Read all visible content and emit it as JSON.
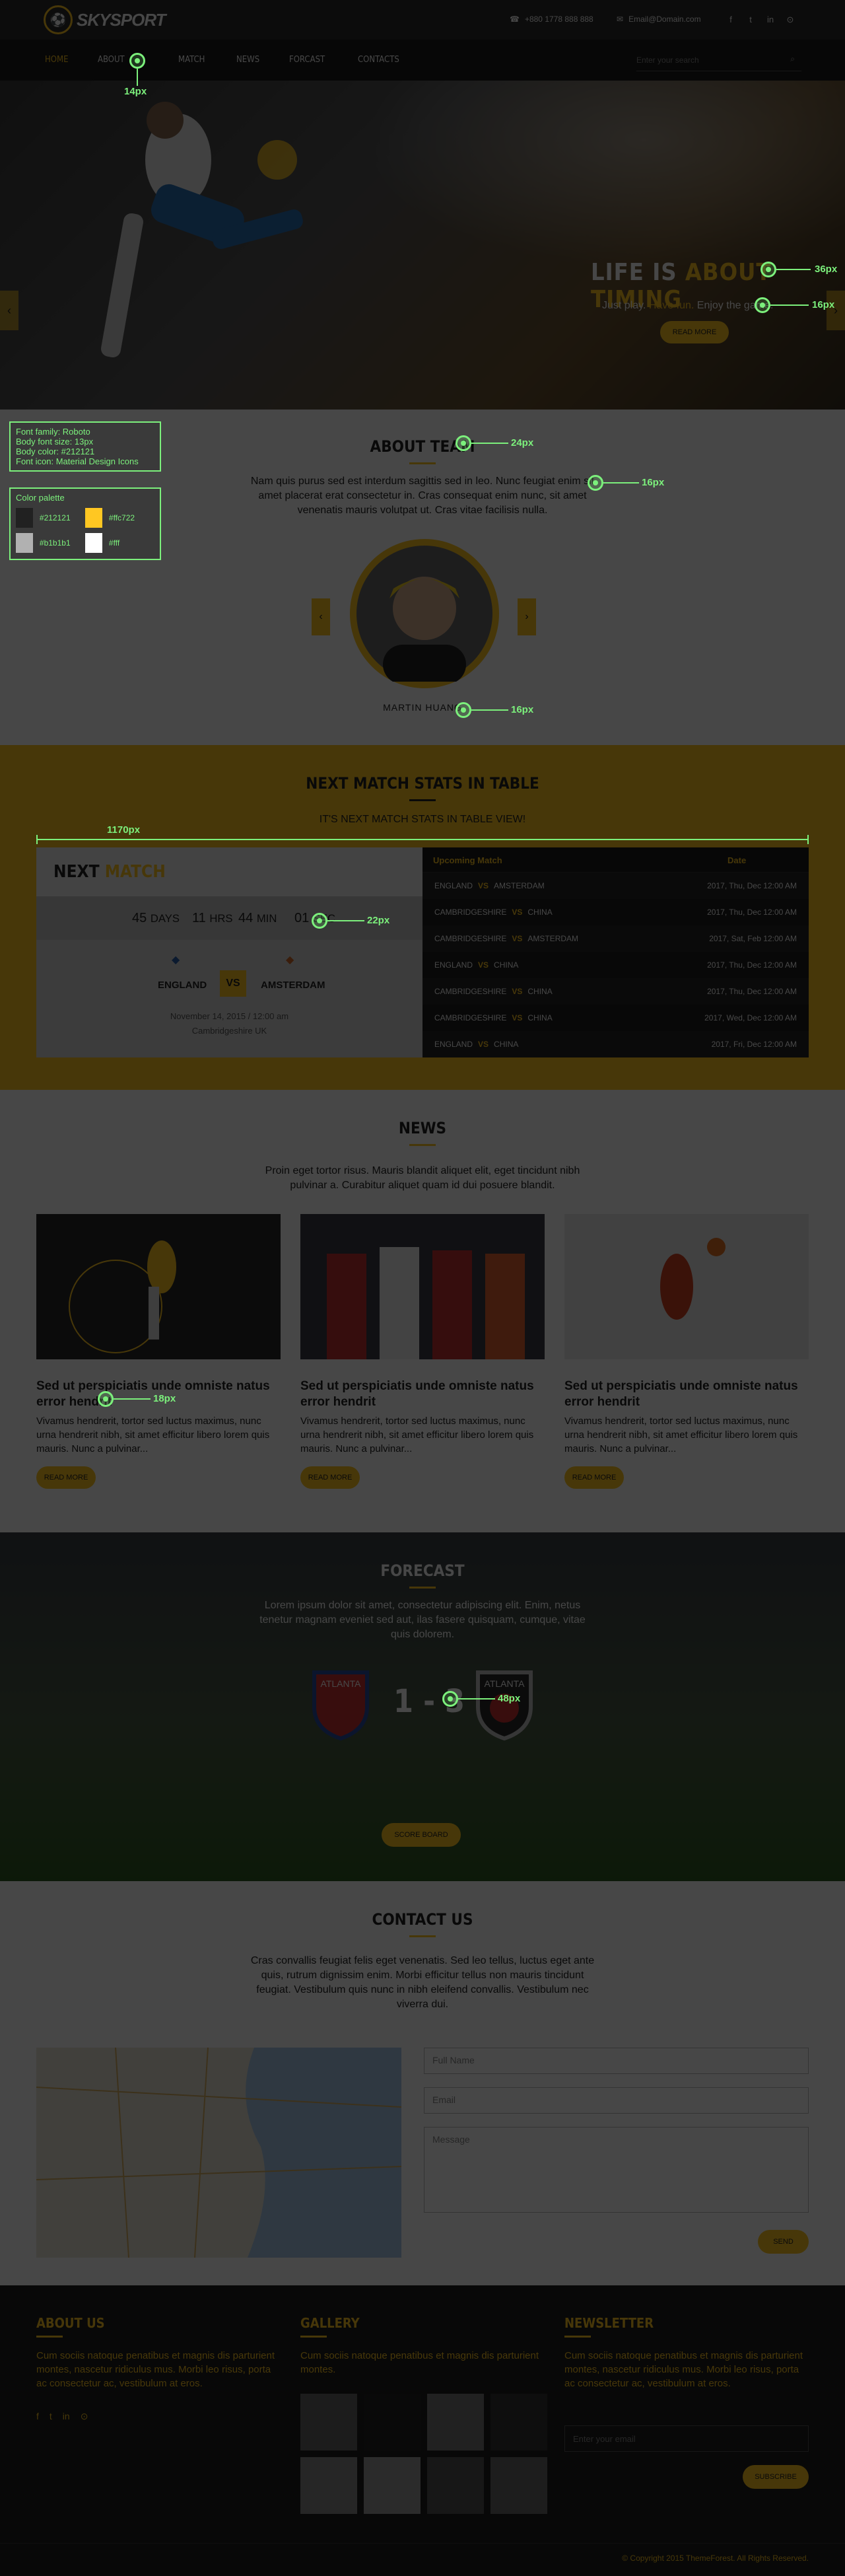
{
  "brand": {
    "logo_text": "SKYSPORT",
    "logo_mark": "⚽"
  },
  "topbar": {
    "phone": "+880 1778 888 888",
    "email": "Email@Domain.com",
    "social": [
      "f",
      "t",
      "in",
      "⊙"
    ]
  },
  "nav": {
    "items": [
      "Home",
      "About",
      "Match",
      "News",
      "Forcast",
      "Contacts"
    ],
    "search_placeholder": "Enter your search"
  },
  "hero": {
    "title_plain": "LIFE IS ",
    "title_accent": "ABOUT TIMING",
    "sub_a": "Just play. ",
    "sub_b": "Have fun.",
    "sub_c": " Enjoy the game.",
    "button": "Read more"
  },
  "spec": {
    "font_lines": [
      "Font family: Roboto",
      "Body font size: 13px",
      "Body color: #212121",
      "Font icon: Material Design Icons"
    ],
    "palette_title": "Color palette",
    "palette": [
      {
        "hex": "#212121",
        "label": "#212121"
      },
      {
        "hex": "#ffc722",
        "label": "#ffc722"
      },
      {
        "hex": "#b1b1b1",
        "label": "#b1b1b1"
      },
      {
        "hex": "#ffffff",
        "label": "#fff"
      }
    ]
  },
  "annotations": {
    "a14": "14px",
    "a36": "36px",
    "a16a": "16px",
    "a24": "24px",
    "a16b": "16px",
    "a16c": "16px",
    "a1170": "1170px",
    "a22": "22px",
    "a18": "18px",
    "a48": "48px"
  },
  "about": {
    "title": "About Team",
    "text": "Nam quis purus sed est interdum sagittis sed in leo. Nunc feugiat enim sit amet placerat erat consectetur in. Cras consequat enim nunc, sit amet venenatis mauris volutpat ut. Cras vitae facilisis nulla.",
    "person": "MARTIN HUANG"
  },
  "nextmatch": {
    "title": "Next Match Stats in Table",
    "sub": "IT'S NEXT MATCH STATS IN TABLE VIEW!",
    "left_title_a": "NEXT ",
    "left_title_b": "MATCH",
    "countdown": [
      {
        "n": "45",
        "u": "DAYS"
      },
      {
        "n": "11",
        "u": "HRS"
      },
      {
        "n": "44",
        "u": "MIN"
      },
      {
        "n": "01",
        "u": "SEC"
      }
    ],
    "team_a": "ENGLAND",
    "team_b": "AMSTERDAM",
    "vs": "VS",
    "date": "November 14, 2015 / 12:00 am",
    "place": "Cambridgeshire UK",
    "table_headers": [
      "Upcoming Match",
      "Date"
    ],
    "rows": [
      [
        "ENGLAND",
        "AMSTERDAM",
        "2017, Thu, Dec 12:00 AM"
      ],
      [
        "CAMBRIDGESHIRE",
        "CHINA",
        "2017, Thu, Dec 12:00 AM"
      ],
      [
        "CAMBRIDGESHIRE",
        "AMSTERDAM",
        "2017, Sat, Feb 12:00 AM"
      ],
      [
        "ENGLAND",
        "CHINA",
        "2017, Thu, Dec 12:00 AM"
      ],
      [
        "CAMBRIDGESHIRE",
        "CHINA",
        "2017, Thu, Dec 12:00 AM"
      ],
      [
        "CAMBRIDGESHIRE",
        "CHINA",
        "2017, Wed, Dec 12:00 AM"
      ],
      [
        "ENGLAND",
        "CHINA",
        "2017, Fri, Dec 12:00 AM"
      ]
    ]
  },
  "news": {
    "title": "News",
    "text": "Proin eget tortor risus. Mauris blandit aliquet elit, eget tincidunt nibh pulvinar a. Curabitur aliquet quam id dui posuere blandit.",
    "cards": [
      {
        "title": "Sed ut perspiciatis unde omniste natus error hendrit",
        "text": "Vivamus hendrerit, tortor sed luctus maximus, nunc urna hendrerit nibh, sit amet efficitur libero lorem quis mauris. Nunc a pulvinar...",
        "btn": "Read more"
      },
      {
        "title": "Sed ut perspiciatis unde omniste natus error hendrit",
        "text": "Vivamus hendrerit, tortor sed luctus maximus, nunc urna hendrerit nibh, sit amet efficitur libero lorem quis mauris. Nunc a pulvinar...",
        "btn": "Read more"
      },
      {
        "title": "Sed ut perspiciatis unde omniste natus error hendrit",
        "text": "Vivamus hendrerit, tortor sed luctus maximus, nunc urna hendrerit nibh, sit amet efficitur libero lorem quis mauris. Nunc a pulvinar...",
        "btn": "Read more"
      }
    ]
  },
  "forecast": {
    "title": "Forecast",
    "text": "Lorem ipsum dolor sit amet, consectetur adipiscing elit. Enim, netus tenetur magnam eveniet sed aut, ilas fasere quisquam, cumque, vitae quis dolorem.",
    "score_a": "1",
    "dash": "-",
    "score_b": "3",
    "badge_a": "ATLANTA",
    "badge_b": "ATLANTA",
    "button": "Score board"
  },
  "contact": {
    "title": "Contact Us",
    "text": "Cras convallis feugiat felis eget venenatis. Sed leo tellus, luctus eget ante quis, rutrum dignissim enim. Morbi efficitur tellus non mauris tincidunt feugiat. Vestibulum quis nunc in nibh eleifend convallis. Vestibulum nec viverra dui.",
    "name_ph": "Full Name",
    "email_ph": "Email",
    "msg_ph": "Message",
    "button": "Send"
  },
  "footer": {
    "about_title": "About us",
    "about_text": "Cum sociis natoque penatibus et magnis dis parturient montes, nascetur ridiculus mus. Morbi leo risus, porta ac consectetur ac, vestibulum at eros.",
    "gallery_title": "Gallery",
    "gallery_text": "Cum sociis natoque penatibus et magnis dis parturient montes.",
    "news_title": "Newsletter",
    "news_text": "Cum sociis natoque penatibus et magnis dis parturient montes, nascetur ridiculus mus. Morbi leo risus, porta ac consectetur ac, vestibulum at eros.",
    "email_ph": "Enter your email",
    "subscribe": "Subscribe",
    "copyright": "© Copyright 2015 ThemeForest. All Rights Reserved."
  }
}
